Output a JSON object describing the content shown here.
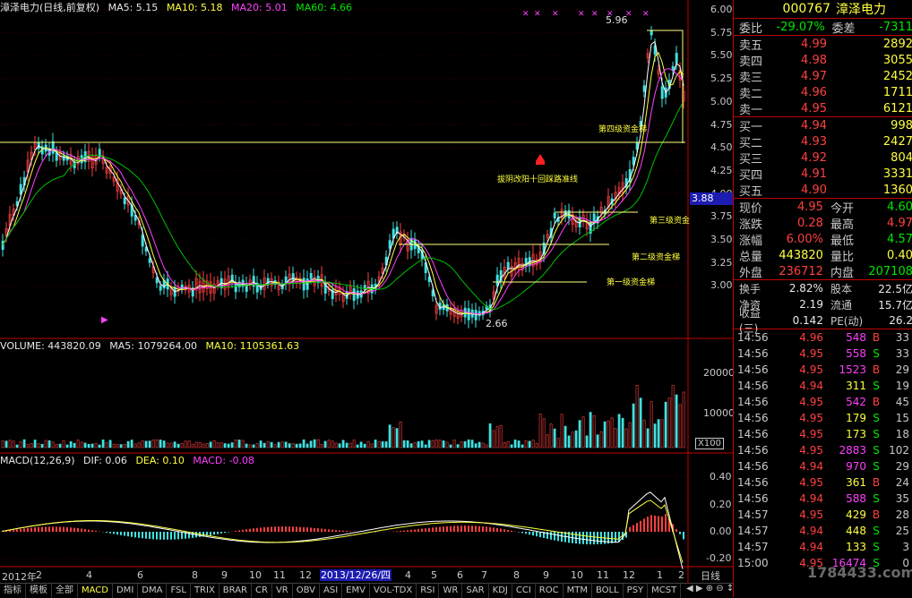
{
  "header": {
    "title": "漳泽电力(日线,前复权)",
    "ma5": "MA5: 5.15",
    "ma10": "MA10: 5.18",
    "ma20": "MA20: 5.01",
    "ma60": "MA60: 4.66"
  },
  "price_axis": [
    "6.00",
    "5.75",
    "5.50",
    "5.25",
    "5.00",
    "4.75",
    "4.50",
    "4.25",
    "4.00",
    "3.75",
    "3.50",
    "3.25",
    "3.00"
  ],
  "price_current": "3.88",
  "annotations": {
    "high": "5.96",
    "low": "2.66",
    "level4": "第四级资金梯",
    "level3": "第三级资金",
    "level2": "第二级资金梯",
    "level1": "第一级资金梯",
    "center": "拔阴改阳十回踩路准线"
  },
  "volume": {
    "label": "VOLUME: 443820.09",
    "ma5": "MA5: 1079264.00",
    "ma10": "MA10: 1105361.63",
    "axis": [
      "20000",
      "10000"
    ],
    "unit": "X100"
  },
  "macd": {
    "label": "MACD(12,26,9)",
    "dif": "DIF: 0.06",
    "dea": "DEA: 0.10",
    "macd": "MACD: -0.08",
    "axis": [
      "0.40",
      "0.20",
      "0.00",
      "-0.20"
    ]
  },
  "time_axis": {
    "months": [
      "2012年",
      "2",
      "4",
      "6",
      "8",
      "9",
      "10",
      "11",
      "12",
      "4",
      "5",
      "6",
      "7",
      "8",
      "9",
      "10",
      "11",
      "12",
      "1",
      "2"
    ],
    "selected_date": "2013/12/26/四",
    "period": "日线"
  },
  "tabs": [
    "指标",
    "模板",
    "全部",
    "MACD",
    "DMI",
    "DMA",
    "FSL",
    "TRIX",
    "BRAR",
    "CR",
    "VR",
    "OBV",
    "ASI",
    "EMV",
    "VOL-TDX",
    "RSI",
    "WR",
    "SAR",
    "KDJ",
    "CCI",
    "ROC",
    "MTM",
    "BOLL",
    "PSY",
    "MCST"
  ],
  "active_tab": "MACD",
  "quote": {
    "code": "000767",
    "name": "漳泽电力",
    "weibi_label": "委比",
    "weibi": "-29.07%",
    "weicha_label": "委差",
    "weicha": "-7311",
    "asks": [
      {
        "label": "卖五",
        "price": "4.99",
        "vol": "2892"
      },
      {
        "label": "卖四",
        "price": "4.98",
        "vol": "3055"
      },
      {
        "label": "卖三",
        "price": "4.97",
        "vol": "2452"
      },
      {
        "label": "卖二",
        "price": "4.96",
        "vol": "1711"
      },
      {
        "label": "卖一",
        "price": "4.95",
        "vol": "6121"
      }
    ],
    "bids": [
      {
        "label": "买一",
        "price": "4.94",
        "vol": "998"
      },
      {
        "label": "买二",
        "price": "4.93",
        "vol": "2427"
      },
      {
        "label": "买三",
        "price": "4.92",
        "vol": "804"
      },
      {
        "label": "买四",
        "price": "4.91",
        "vol": "3331"
      },
      {
        "label": "买五",
        "price": "4.90",
        "vol": "1360"
      }
    ],
    "stats": [
      {
        "l1": "现价",
        "v1": "4.95",
        "c1": "red",
        "l2": "今开",
        "v2": "4.60",
        "c2": "grn"
      },
      {
        "l1": "涨跌",
        "v1": "0.28",
        "c1": "red",
        "l2": "最高",
        "v2": "4.97",
        "c2": "red"
      },
      {
        "l1": "涨幅",
        "v1": "6.00%",
        "c1": "red",
        "l2": "最低",
        "v2": "4.57",
        "c2": "grn"
      },
      {
        "l1": "总量",
        "v1": "443820",
        "c1": "yel",
        "l2": "量比",
        "v2": "0.40",
        "c2": "yel"
      },
      {
        "l1": "外盘",
        "v1": "236712",
        "c1": "red",
        "l2": "内盘",
        "v2": "207108",
        "c2": "grn"
      }
    ],
    "stats2": [
      {
        "l1": "换手",
        "v1": "2.82%",
        "l2": "股本",
        "v2": "22.5亿"
      },
      {
        "l1": "净资",
        "v1": "2.19",
        "l2": "流通",
        "v2": "15.7亿"
      },
      {
        "l1": "收益(三)",
        "v1": "0.142",
        "l2": "PE(动)",
        "v2": "26.2"
      }
    ],
    "ticks": [
      {
        "t": "14:56",
        "p": "4.96",
        "v": "548",
        "f": "B",
        "n": "33"
      },
      {
        "t": "14:56",
        "p": "4.95",
        "v": "558",
        "f": "S",
        "n": "33"
      },
      {
        "t": "14:56",
        "p": "4.95",
        "v": "1523",
        "f": "B",
        "n": "29"
      },
      {
        "t": "14:56",
        "p": "4.94",
        "v": "311",
        "f": "S",
        "n": "19"
      },
      {
        "t": "14:56",
        "p": "4.95",
        "v": "542",
        "f": "B",
        "n": "45"
      },
      {
        "t": "14:56",
        "p": "4.95",
        "v": "179",
        "f": "S",
        "n": "15"
      },
      {
        "t": "14:56",
        "p": "4.95",
        "v": "173",
        "f": "S",
        "n": "18"
      },
      {
        "t": "14:56",
        "p": "4.95",
        "v": "2883",
        "f": "S",
        "n": "102"
      },
      {
        "t": "14:56",
        "p": "4.94",
        "v": "970",
        "f": "S",
        "n": "29"
      },
      {
        "t": "14:56",
        "p": "4.95",
        "v": "361",
        "f": "B",
        "n": "24"
      },
      {
        "t": "14:56",
        "p": "4.94",
        "v": "588",
        "f": "S",
        "n": "35"
      },
      {
        "t": "14:57",
        "p": "4.95",
        "v": "429",
        "f": "B",
        "n": "28"
      },
      {
        "t": "14:57",
        "p": "4.94",
        "v": "448",
        "f": "S",
        "n": "25"
      },
      {
        "t": "14:57",
        "p": "4.94",
        "v": "133",
        "f": "S",
        "n": "3"
      },
      {
        "t": "15:00",
        "p": "4.95",
        "v": "16474",
        "f": "S",
        "n": "0"
      }
    ],
    "watermark": "1784433.com"
  }
}
